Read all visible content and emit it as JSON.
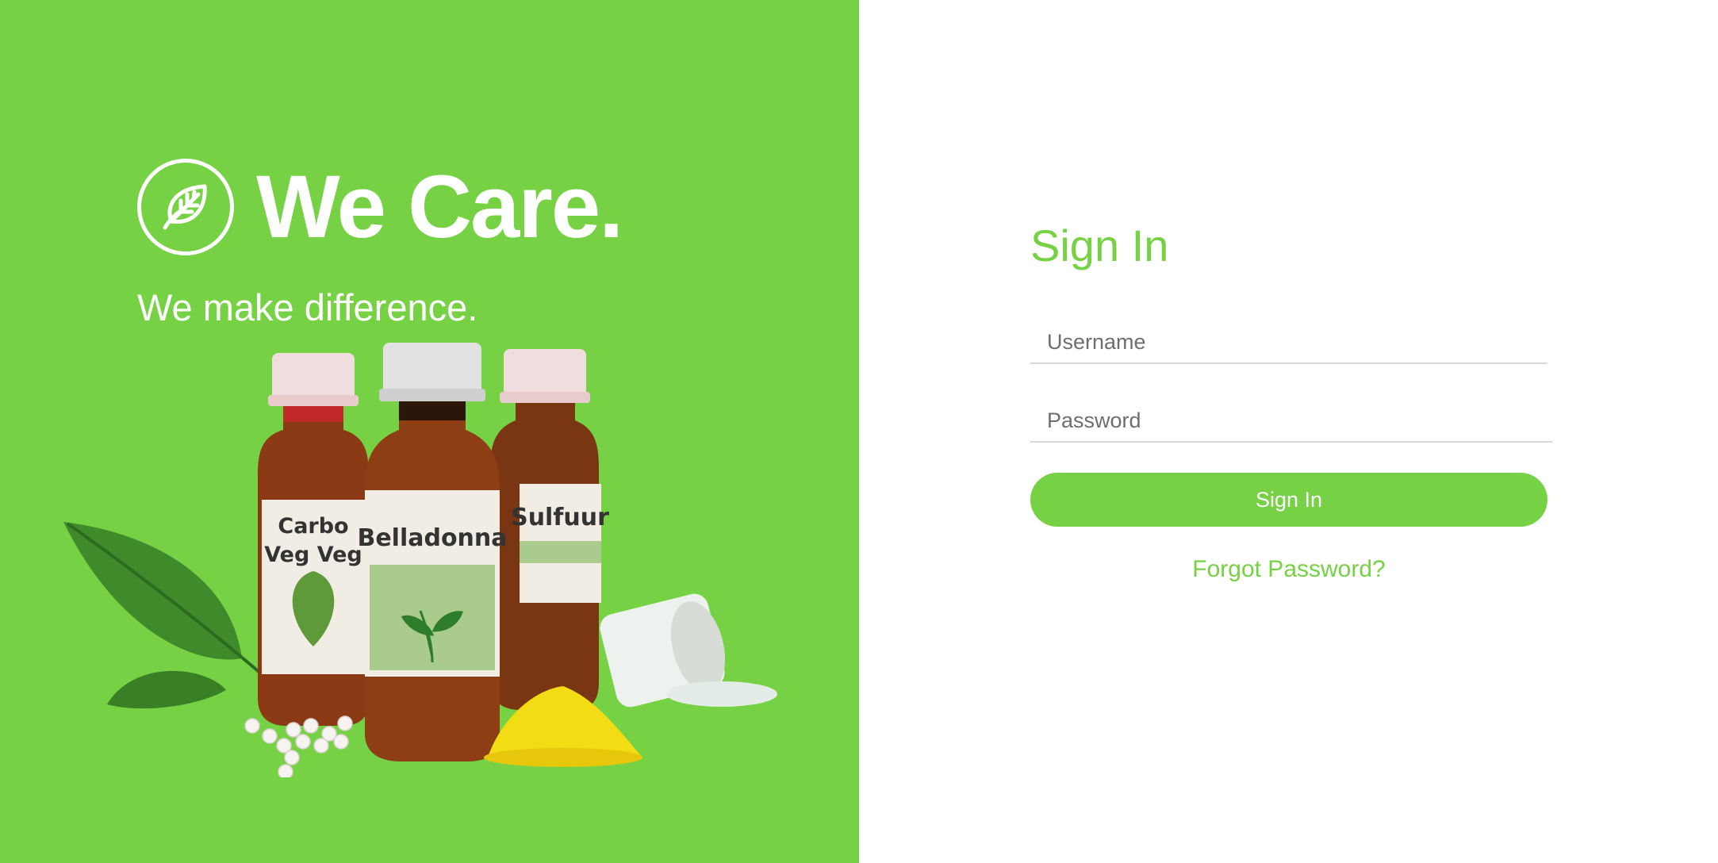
{
  "brand": {
    "name": "We Care.",
    "tagline": "We make difference.",
    "logo_icon": "leaf-icon"
  },
  "products": {
    "bottle_left_label": "Carbo Veg Veg",
    "bottle_center_label": "Belladonna",
    "bottle_right_label": "Sulfuur"
  },
  "signin": {
    "title": "Sign In",
    "username_placeholder": "Username",
    "password_placeholder": "Password",
    "submit_label": "Sign In",
    "forgot_label": "Forgot Password?"
  },
  "colors": {
    "brand_green": "#76d144",
    "background": "#ffffff",
    "input_border": "#d9d9d9"
  }
}
